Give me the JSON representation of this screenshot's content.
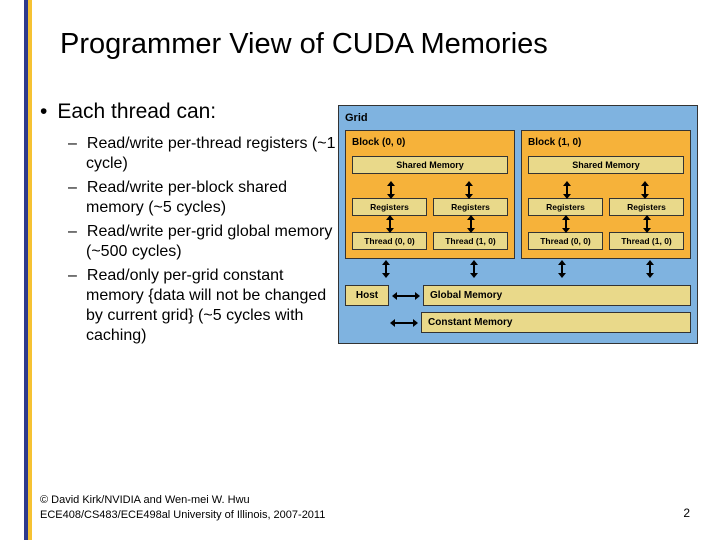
{
  "title": "Programmer View of  CUDA Memories",
  "main_bullet": "Each thread can:",
  "subs": [
    "Read/write per-thread registers (~1 cycle)",
    "Read/write per-block shared memory (~5 cycles)",
    "Read/write per-grid global memory (~500 cycles)",
    "Read/only per-grid constant memory {data will not be changed by current grid} (~5 cycles with caching)"
  ],
  "footer": {
    "line1": "© David Kirk/NVIDIA and Wen-mei W. Hwu",
    "line2": "ECE408/CS483/ECE498al University of Illinois, 2007-2011"
  },
  "page_number": "2",
  "diagram": {
    "grid_label": "Grid",
    "blocks": [
      {
        "label": "Block (0, 0)",
        "shared": "Shared Memory",
        "regs": [
          "Registers",
          "Registers"
        ],
        "threads": [
          "Thread (0, 0)",
          "Thread (1, 0)"
        ]
      },
      {
        "label": "Block (1, 0)",
        "shared": "Shared Memory",
        "regs": [
          "Registers",
          "Registers"
        ],
        "threads": [
          "Thread (0, 0)",
          "Thread (1, 0)"
        ]
      }
    ],
    "host": "Host",
    "global_memory": "Global Memory",
    "constant_memory": "Constant Memory"
  }
}
